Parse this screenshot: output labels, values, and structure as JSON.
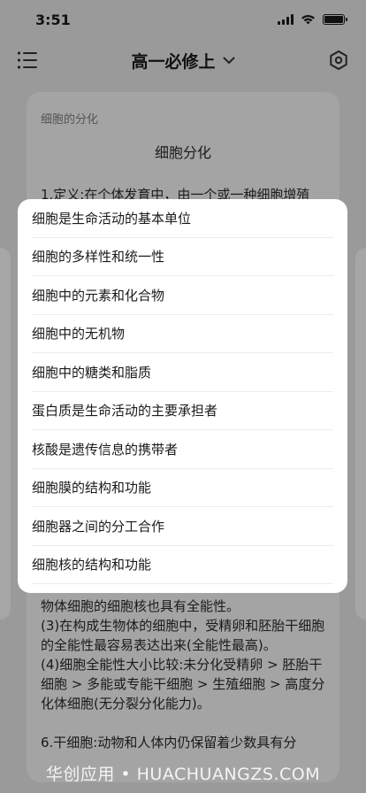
{
  "status_bar": {
    "time": "3:51"
  },
  "nav": {
    "title": "高一必修上",
    "title_icon": "chevron-down-icon",
    "left_icon": "menu-list-icon",
    "right_icon": "settings-hexagon-icon"
  },
  "article": {
    "breadcrumb": "细胞的分化",
    "title": "细胞分化",
    "top_text": "1.定义:在个体发育中，由一个或一种细胞增殖",
    "bottom_paragraphs": [
      "物体细胞的细胞核也具有全能性。",
      "(3)在构成生物体的细胞中，受精卵和胚胎干细胞的全能性最容易表达出来(全能性最高)。",
      "(4)细胞全能性大小比较:未分化受精卵 > 胚胎干细胞 > 多能或专能干细胞 > 生殖细胞 > 高度分化体细胞(无分裂分化能力)。",
      "",
      "6.干细胞:动物和人体内仍保留着少数具有分"
    ]
  },
  "menu": {
    "items": [
      "细胞是生命活动的基本单位",
      "细胞的多样性和统一性",
      "细胞中的元素和化合物",
      "细胞中的无机物",
      "细胞中的糖类和脂质",
      "蛋白质是生命活动的主要承担者",
      "核酸是遗传信息的携带者",
      "细胞膜的结构和功能",
      "细胞器之间的分工合作",
      "细胞核的结构和功能"
    ]
  },
  "watermark": "华创应用 • HUACHUANGZS.COM"
}
